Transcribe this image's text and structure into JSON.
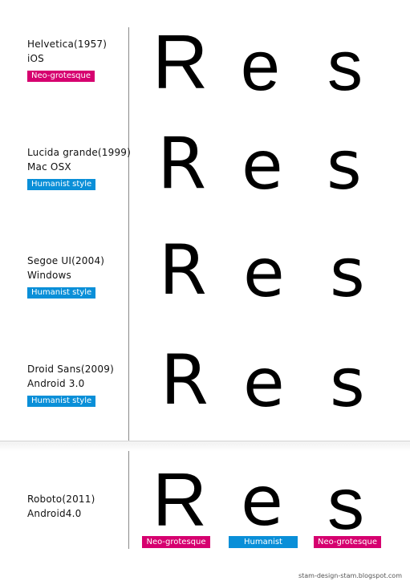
{
  "fonts": [
    {
      "name": "Helvetica(1957)",
      "platform": "iOS",
      "style": "Neo-grotesque",
      "style_color": "#d6006f",
      "sample": [
        "R",
        "e",
        "s"
      ]
    },
    {
      "name": "Lucida grande(1999)",
      "platform": "Mac OSX",
      "style": "Humanist style",
      "style_color": "#0a8fd8",
      "sample": [
        "R",
        "e",
        "s"
      ]
    },
    {
      "name": "Segoe UI(2004)",
      "platform": "Windows",
      "style": "Humanist style",
      "style_color": "#0a8fd8",
      "sample": [
        "R",
        "e",
        "s"
      ]
    },
    {
      "name": "Droid Sans(2009)",
      "platform": "Android 3.0",
      "style": "Humanist style",
      "style_color": "#0a8fd8",
      "sample": [
        "R",
        "e",
        "s"
      ]
    },
    {
      "name": "Roboto(2011)",
      "platform": "Android4.0",
      "sample": [
        "R",
        "e",
        "s"
      ]
    }
  ],
  "roboto_badges": [
    {
      "label": "Neo-grotesque",
      "color": "#d6006f"
    },
    {
      "label": "Humanist",
      "color": "#0a8fd8"
    },
    {
      "label": "Neo-grotesque",
      "color": "#d6006f"
    }
  ],
  "credit": "stam-design-stam.blogspot.com"
}
